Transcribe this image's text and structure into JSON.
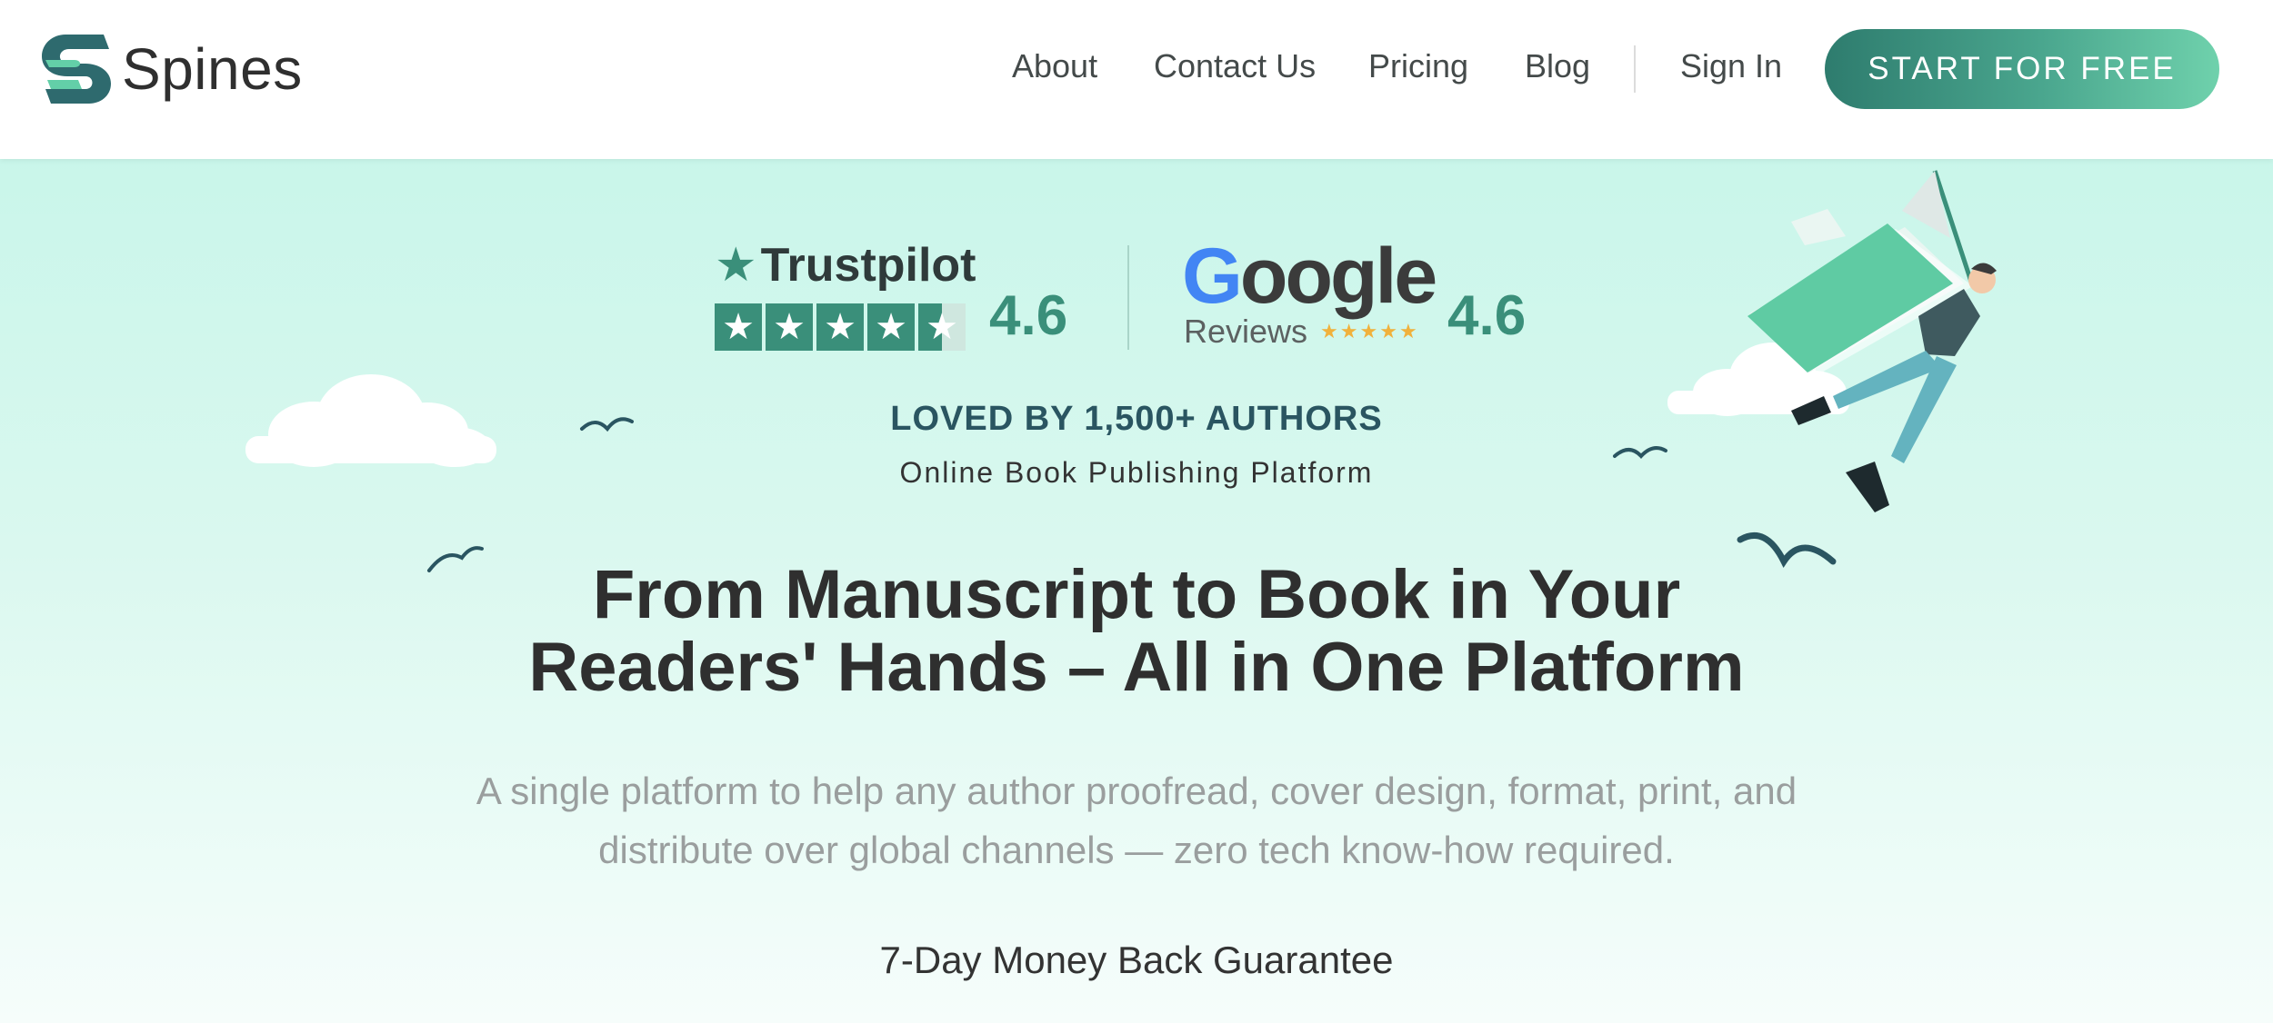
{
  "header": {
    "logo_text": "Spines",
    "nav": {
      "about": "About",
      "contact": "Contact Us",
      "pricing": "Pricing",
      "blog": "Blog",
      "sign_in": "Sign In"
    },
    "cta_label": "START FOR FREE"
  },
  "ratings": {
    "trustpilot": {
      "name": "Trustpilot",
      "rating": "4.6",
      "stars": 4.5
    },
    "google": {
      "name": "Google",
      "sub": "Reviews",
      "rating": "4.6",
      "stars": 4.5
    }
  },
  "hero": {
    "loved": "LOVED BY 1,500+ AUTHORS",
    "tagline": "Online Book Publishing Platform",
    "headline_line1": "From Manuscript to Book in Your",
    "headline_line2": "Readers' Hands – All in One Platform",
    "subhead": "A single platform to help any author proofread, cover design, format, print, and distribute over global channels — zero tech know-how required.",
    "guarantee": "7-Day Money Back Guarantee"
  },
  "colors": {
    "brand": "#3a8f7a",
    "cta_start": "#2e7c6e",
    "cta_end": "#6fd1ac",
    "hero_bg": "#c9f6ea",
    "dark_text": "#2f2f2f"
  },
  "icons": [
    "spines-logo-icon",
    "trustpilot-star-icon",
    "cloud-icon",
    "bird-icon",
    "flying-book-man-illustration"
  ]
}
